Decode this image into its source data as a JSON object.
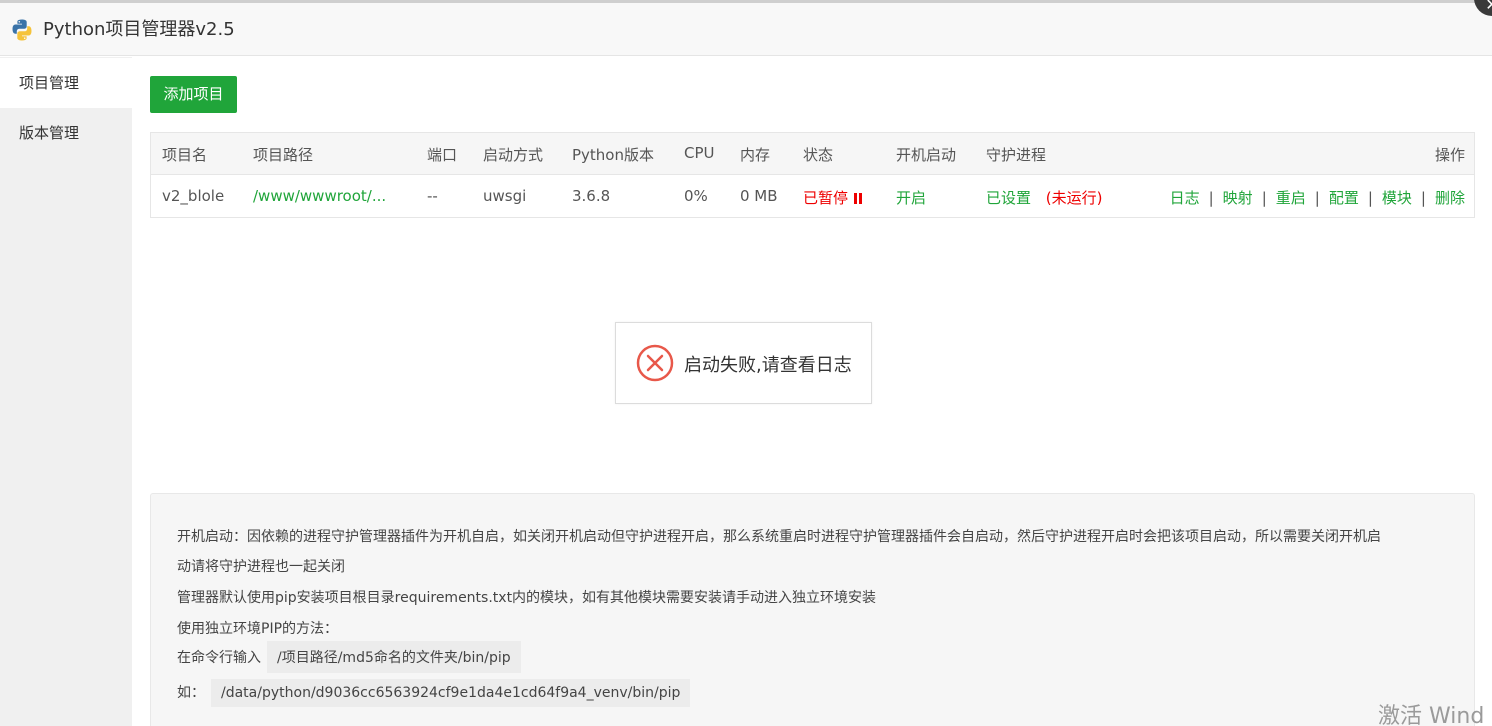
{
  "window": {
    "title": "Python项目管理器v2.5",
    "close_icon": "close-icon"
  },
  "sidebar": {
    "items": [
      {
        "label": "项目管理",
        "active": true
      },
      {
        "label": "版本管理",
        "active": false
      }
    ]
  },
  "toolbar": {
    "add_label": "添加项目"
  },
  "table": {
    "headers": [
      "项目名",
      "项目路径",
      "端口",
      "启动方式",
      "Python版本",
      "CPU",
      "内存",
      "状态",
      "开机启动",
      "守护进程",
      "操作"
    ],
    "rows": [
      {
        "name": "v2_blole",
        "path": "/www/wwwroot/...",
        "port": "--",
        "start_mode": "uwsgi",
        "python_version": "3.6.8",
        "cpu": "0%",
        "memory": "0 MB",
        "status": "已暂停",
        "status_icon": "pause-icon",
        "autostart": "开启",
        "daemon": "已设置",
        "daemon_note": "(未运行)",
        "actions": [
          "日志",
          "映射",
          "重启",
          "配置",
          "模块",
          "删除"
        ]
      }
    ]
  },
  "toast": {
    "icon": "error-circle-icon",
    "message": "启动失败,请查看日志"
  },
  "help": {
    "line1": "开机启动：因依赖的进程守护管理器插件为开机自启，如关闭开机启动但守护进程开启，那么系统重启时进程守护管理器插件会自启动，然后守护进程开启时会把该项目启动，所以需要关闭开机启",
    "line2": "动请将守护进程也一起关闭",
    "line3": "管理器默认使用pip安装项目根目录requirements.txt内的模块，如有其他模块需要安装请手动进入独立环境安装",
    "line4": "使用独立环境PIP的方法：",
    "line5_label": "在命令行输入",
    "line5_code": "/项目路径/md5命名的文件夹/bin/pip",
    "line6_label": "如：",
    "line6_code": "/data/python/d9036cc6563924cf9e1da4e1cd64f9a4_venv/bin/pip"
  },
  "watermark": {
    "text": "激活 Wind"
  },
  "colors": {
    "accent": "#20a53a",
    "danger": "#ee0000",
    "sidebar_bg": "#f0f0f0"
  }
}
